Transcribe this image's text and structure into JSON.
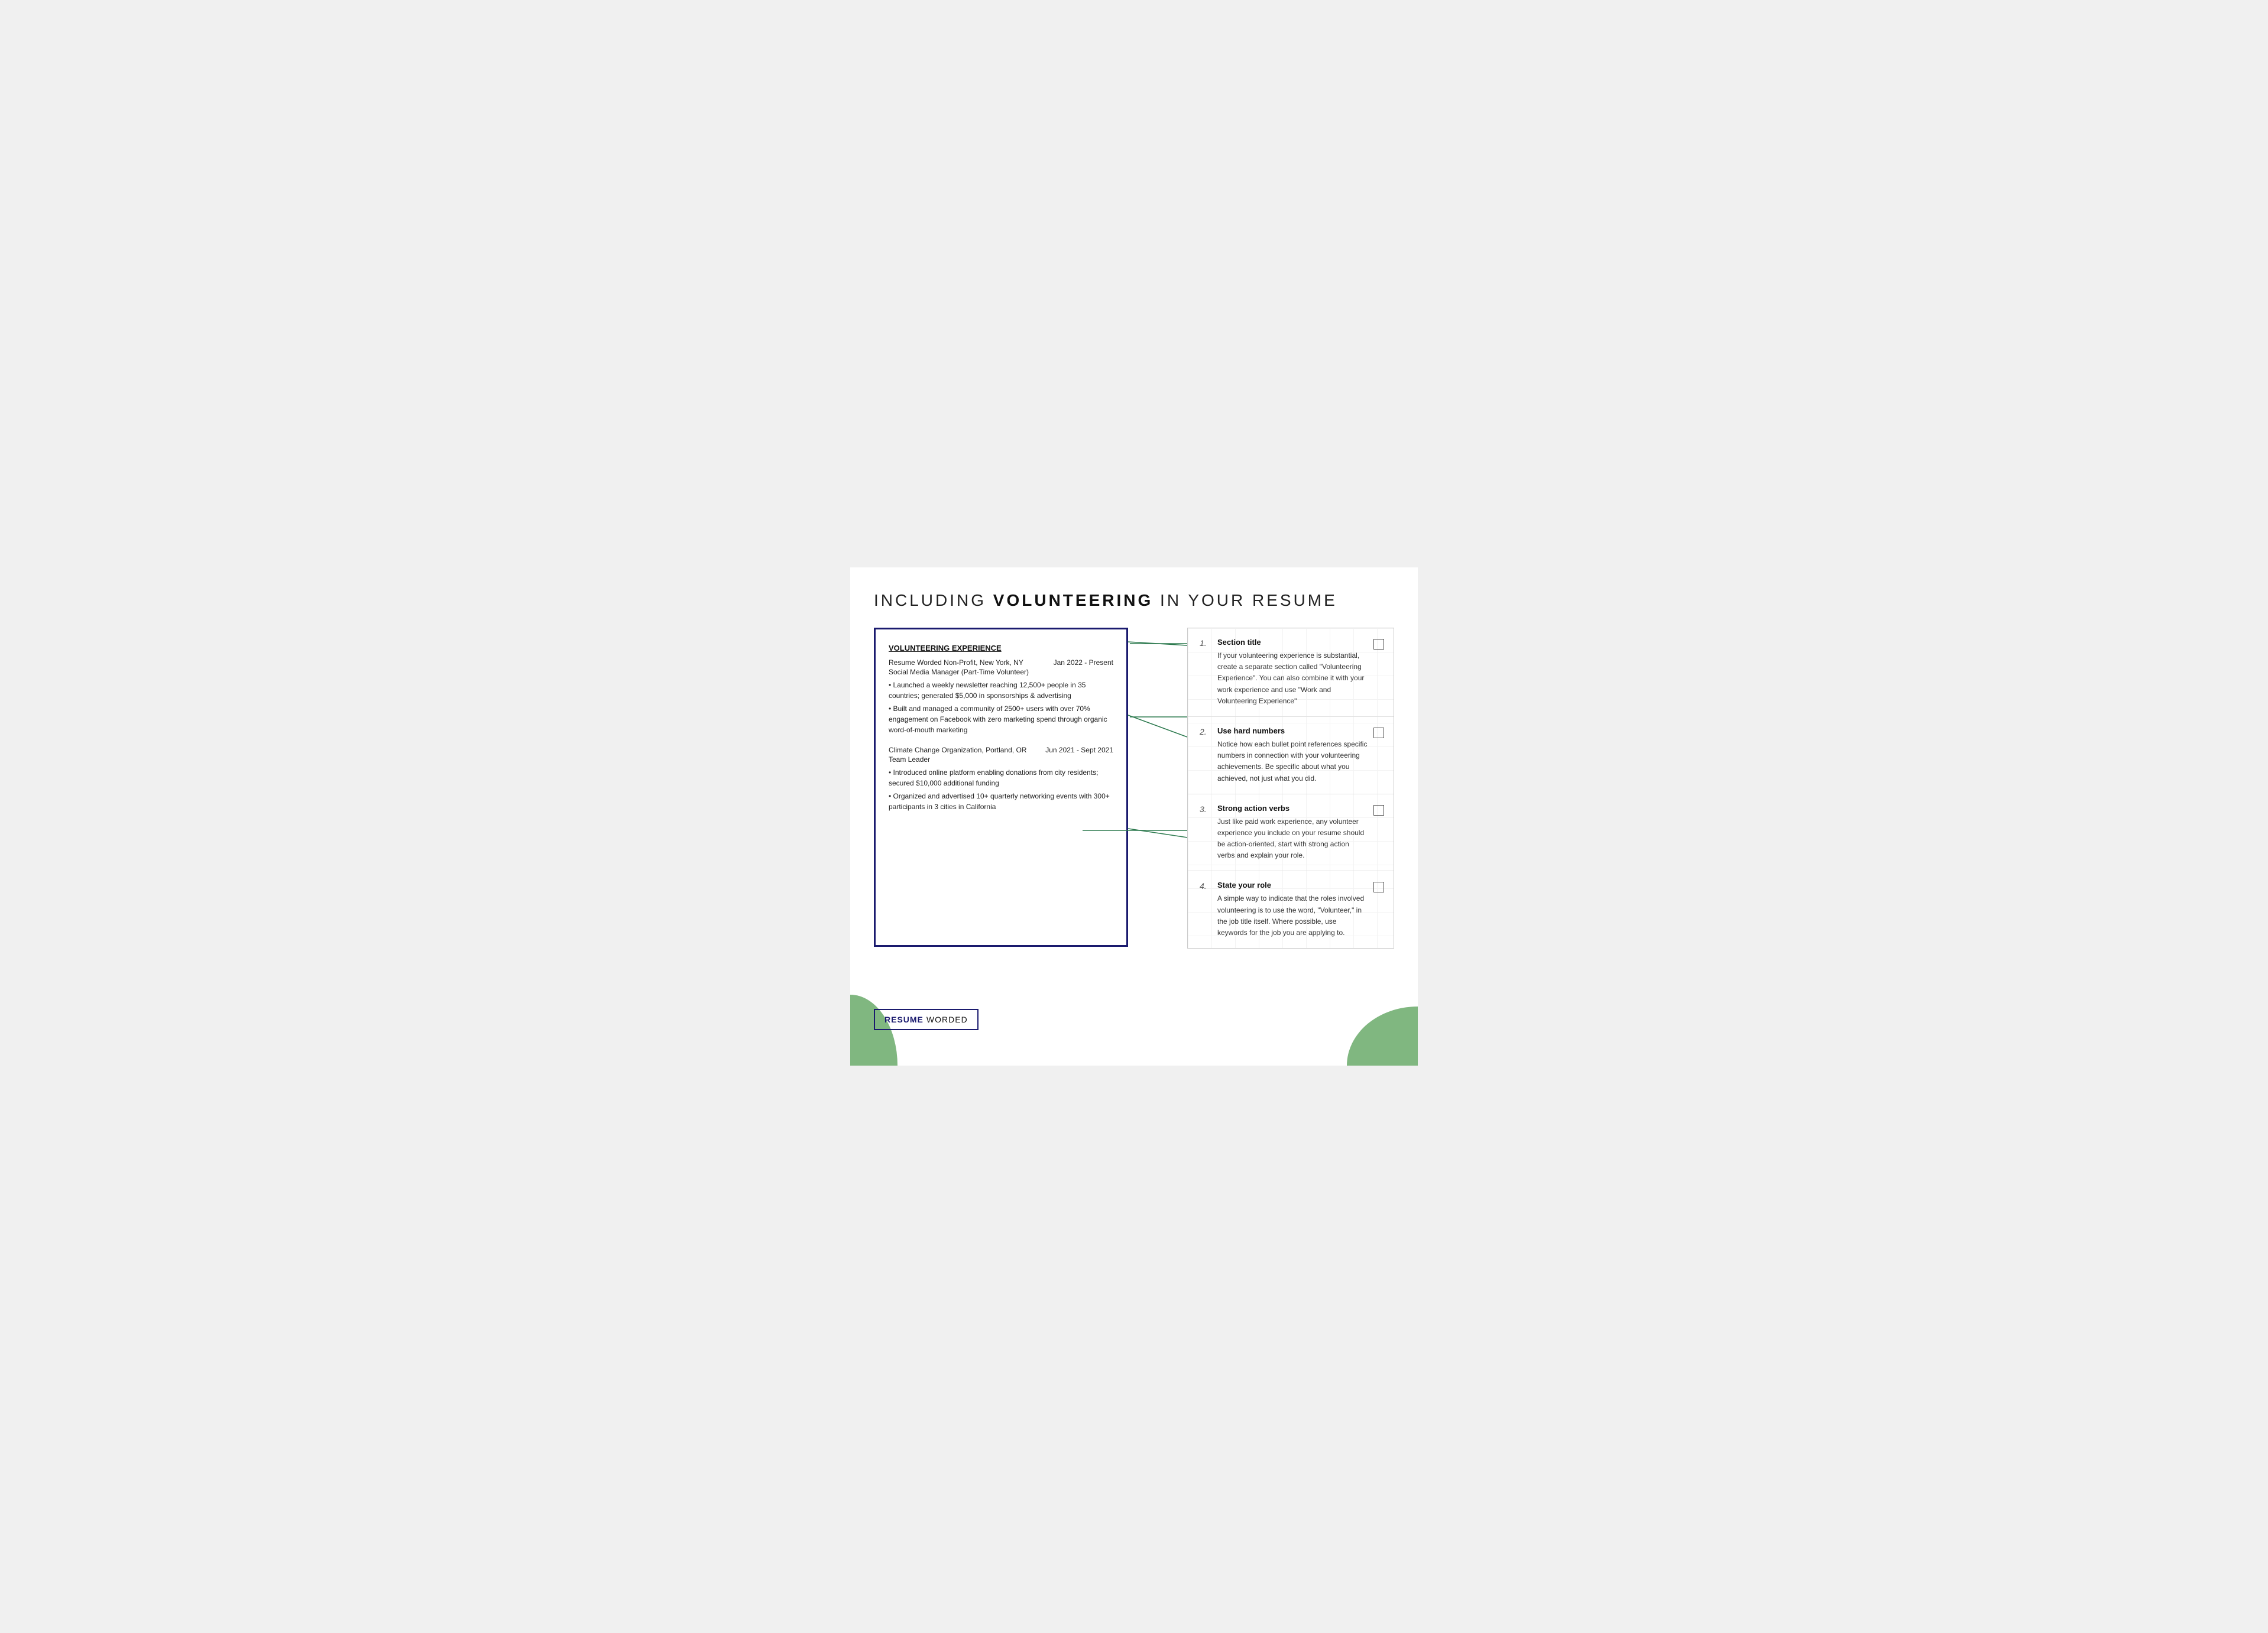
{
  "page": {
    "title_prefix": "INCLUDING ",
    "title_bold": "VOLUNTEERING",
    "title_suffix": " IN YOUR RESUME",
    "background_color": "#f0f0f0"
  },
  "resume_panel": {
    "section_title": "VOLUNTEERING EXPERIENCE",
    "entries": [
      {
        "org": "Resume Worded Non-Profit, New York, NY",
        "date": "Jan 2022 - Present",
        "role": "Social Media Manager (Part-Time Volunteer)",
        "bullets": [
          "• Launched a weekly newsletter reaching 12,500+ people in 35 countries; generated $5,000 in sponsorships & advertising",
          "• Built and managed a community of 2500+ users with over 70% engagement on Facebook with zero marketing spend through organic word-of-mouth marketing"
        ]
      },
      {
        "org": "Climate Change Organization, Portland, OR",
        "date": "Jun 2021 - Sept 2021",
        "role": "Team Leader",
        "bullets": [
          "• Introduced online platform enabling donations from city residents; secured $10,000 additional funding",
          "• Organized and advertised 10+ quarterly networking events with 300+ participants in 3 cities in California"
        ]
      }
    ]
  },
  "tips": [
    {
      "number": "1.",
      "title": "Section title",
      "text": "If your volunteering experience is substantial, create a separate section called \"Volunteering Experience\". You can also combine it with your work experience and use \"Work and Volunteering Experience\""
    },
    {
      "number": "2.",
      "title": "Use hard numbers",
      "text": "Notice how each bullet point references specific numbers in connection with your volunteering achievements. Be specific about what you achieved, not just what you did."
    },
    {
      "number": "3.",
      "title": "Strong action verbs",
      "text": "Just like paid work experience, any volunteer experience you include on your resume should be action-oriented, start with strong action verbs and explain your role."
    },
    {
      "number": "4.",
      "title": "State your role",
      "text": "A simple way to indicate that the roles involved volunteering is to use the word, \"Volunteer,\" in the job title itself. Where possible, use keywords for the job you are applying to."
    }
  ],
  "branding": {
    "resume": "RESUME",
    "worded": "WORDED"
  },
  "colors": {
    "navy": "#1a1a6e",
    "green_line": "#2d7a4f",
    "green_shape": "#6aaa6a"
  }
}
